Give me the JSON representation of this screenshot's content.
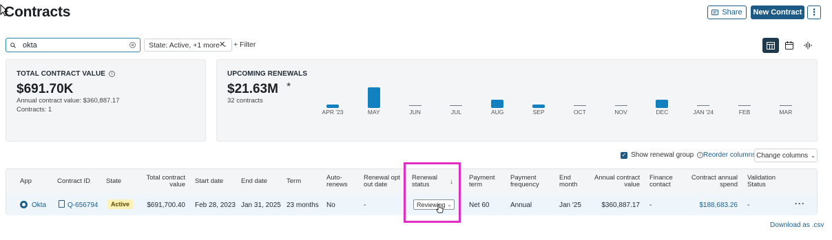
{
  "header": {
    "title": "Contracts",
    "share_label": "Share",
    "new_contract_label": "New Contract",
    "more_label": "⋮"
  },
  "filters": {
    "search_value": "okta",
    "state_chip": "State: Active, +1 more",
    "add_filter_label": "+ Filter"
  },
  "tcv_card": {
    "label": "TOTAL CONTRACT VALUE",
    "value": "$691.70K",
    "annual_value": "Annual contract value:  $360,887.17",
    "contracts": "Contracts:  1"
  },
  "renewals_card": {
    "label": "UPCOMING RENEWALS",
    "value": "$21.63M",
    "asterisk": "*",
    "contracts": "32 contracts",
    "chart_data": {
      "type": "bar",
      "categories": [
        "APR '23",
        "MAY",
        "JUN",
        "JUL",
        "AUG",
        "SEP",
        "OCT",
        "NOV",
        "DEC",
        "JAN '24",
        "FEB",
        "MAR"
      ],
      "values": [
        0.15,
        1.0,
        0,
        0,
        0.4,
        0.15,
        0,
        0,
        0.4,
        0,
        0,
        0
      ],
      "bar_color": "#1380bf"
    }
  },
  "table_controls": {
    "show_renewal_group": "Show renewal group",
    "reorder_columns": "Reorder columns",
    "change_columns": "Change columns"
  },
  "columns": {
    "app": "App",
    "contract_id": "Contract ID",
    "state": "State",
    "tcv_1": "Total contract",
    "tcv_2": "value",
    "start": "Start date",
    "end": "End date",
    "term": "Term",
    "auto_1": "Auto-",
    "auto_2": "renews",
    "rood_1": "Renewal opt",
    "rood_2": "out date",
    "rs_1": "Renewal",
    "rs_2": "status",
    "pt_1": "Payment",
    "pt_2": "term",
    "pf_1": "Payment",
    "pf_2": "frequency",
    "em_1": "End",
    "em_2": "month",
    "acv_1": "Annual contract",
    "acv_2": "value",
    "fc_1": "Finance",
    "fc_2": "contact",
    "cas_1": "Contract annual",
    "cas_2": "spend",
    "vs_1": "Validation",
    "vs_2": "Status"
  },
  "row": {
    "app": "Okta",
    "contract_id": "Q-656794",
    "state": "Active",
    "tcv": "$691,700.40",
    "start": "Feb 28, 2023",
    "end": "Jan 31, 2025",
    "term": "23 months",
    "auto_renews": "No",
    "renewal_opt_out": "-",
    "renewal_status": "Reviewing",
    "payment_term": "Net 60",
    "payment_frequency": "Annual",
    "end_month": "Jan '25",
    "acv": "$360,887.17",
    "finance_contact": "-",
    "annual_spend": "$188,683.26",
    "validation": "-",
    "more": "···"
  },
  "footer": {
    "download": "Download as .csv"
  },
  "colors": {
    "primary": "#1d5a85",
    "highlight": "#e02ec2",
    "active_badge": "#fdf1b8"
  }
}
